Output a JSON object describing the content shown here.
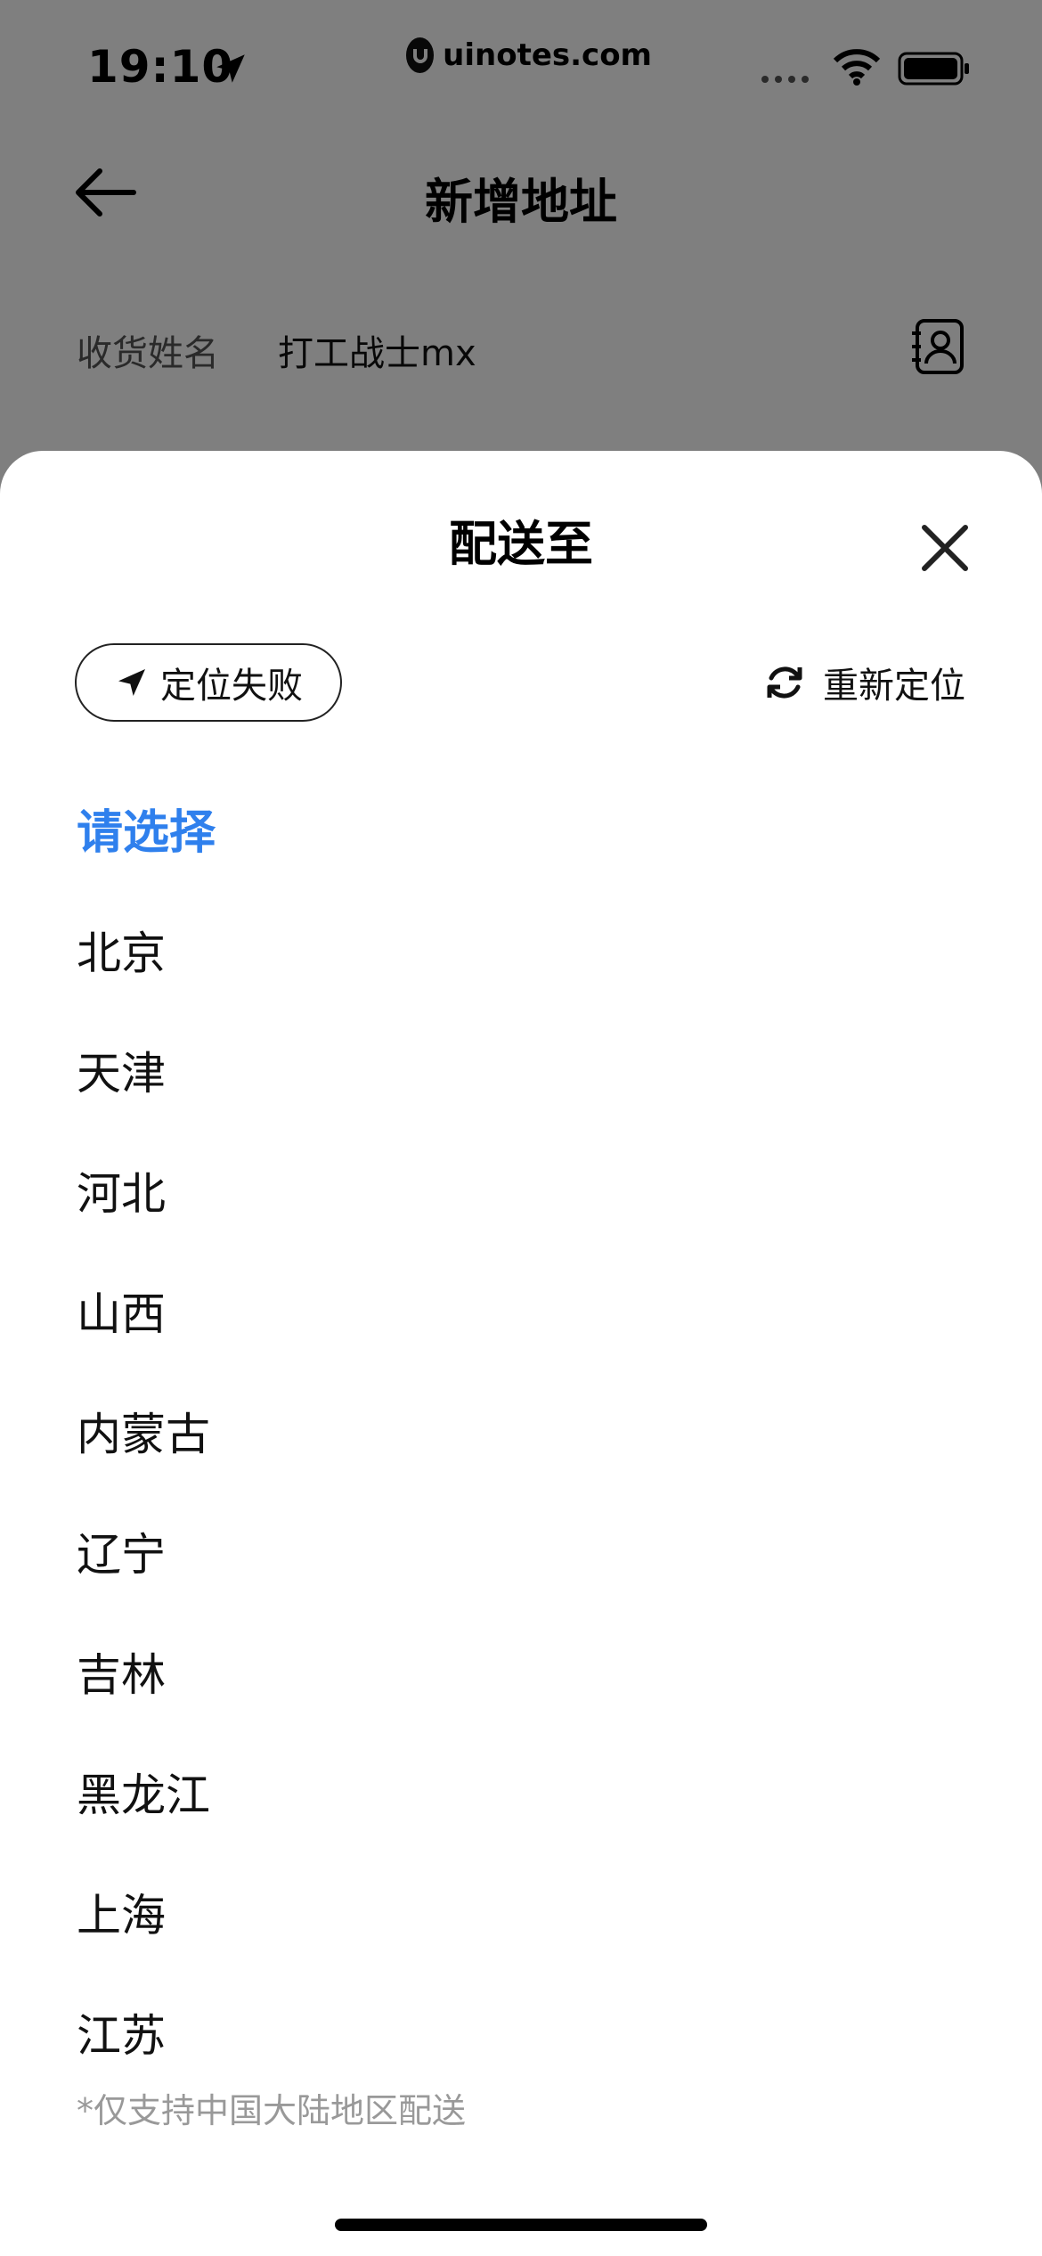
{
  "status_bar": {
    "time": "19:10",
    "url": "uinotes.com"
  },
  "nav": {
    "title": "新增地址"
  },
  "form": {
    "name_label": "收货姓名",
    "name_value": "打工战士mx"
  },
  "sheet": {
    "title": "配送至",
    "location_status": "定位失败",
    "relocate_label": "重新定位",
    "select_prompt": "请选择",
    "provinces": [
      "北京",
      "天津",
      "河北",
      "山西",
      "内蒙古",
      "辽宁",
      "吉林",
      "黑龙江",
      "上海",
      "江苏"
    ],
    "footnote": "*仅支持中国大陆地区配送"
  },
  "colors": {
    "accent": "#2f80ed",
    "overlay": "#808080"
  },
  "icons": {
    "status_location": "location-arrow-icon",
    "back": "back-arrow-icon",
    "contacts": "contact-book-icon",
    "close": "close-icon",
    "location_pill": "location-arrow-icon",
    "relocate": "refresh-icon"
  }
}
